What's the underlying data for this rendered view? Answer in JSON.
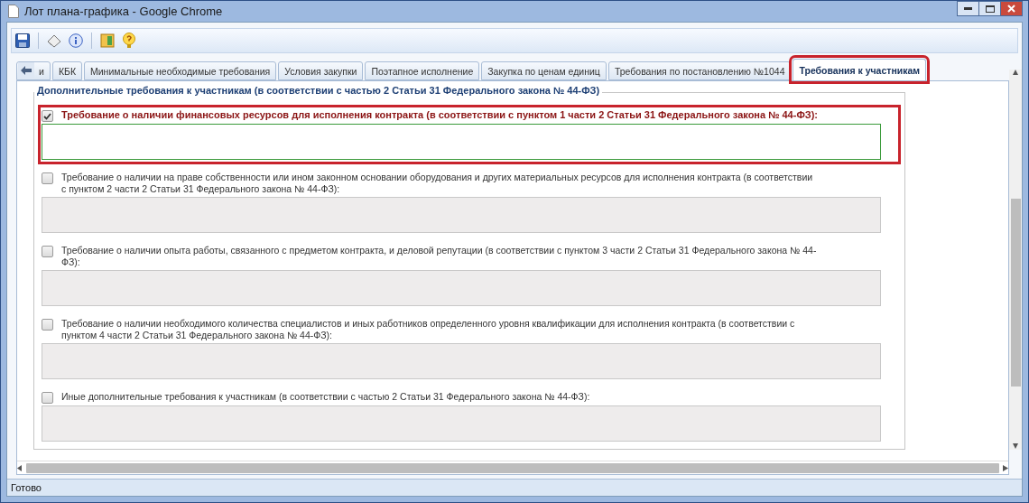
{
  "window": {
    "title": "Лот плана-графика - Google Chrome"
  },
  "tabs": [
    {
      "label": "и",
      "selected": false,
      "highlighted": false
    },
    {
      "label": "КБК",
      "selected": false,
      "highlighted": false
    },
    {
      "label": "Минимальные необходимые требования",
      "selected": false,
      "highlighted": false
    },
    {
      "label": "Условия закупки",
      "selected": false,
      "highlighted": false
    },
    {
      "label": "Поэтапное исполнение",
      "selected": false,
      "highlighted": false
    },
    {
      "label": "Закупка по ценам единиц",
      "selected": false,
      "highlighted": false
    },
    {
      "label": "Требования по постановлению №1044",
      "selected": false,
      "highlighted": false
    },
    {
      "label": "Требования к участникам",
      "selected": true,
      "highlighted": true
    }
  ],
  "group": {
    "legend": "Дополнительные требования к участникам (в соответствии с частью 2 Статьи 31 Федерального закона № 44-ФЗ)",
    "items": [
      {
        "label": "Требование о наличии финансовых ресурсов для исполнения контракта (в соответствии с пунктом 1 части 2 Статьи 31 Федерального закона № 44-ФЗ):",
        "checked": true,
        "highlighted": true
      },
      {
        "label": "Требование о наличии на праве собственности или ином законном основании оборудования и других материальных ресурсов для исполнения контракта (в соответствии с пунктом 2 части 2 Статьи 31 Федерального закона № 44-ФЗ):",
        "checked": false,
        "highlighted": false
      },
      {
        "label": "Требование о наличии опыта работы, связанного с предметом контракта, и деловой репутации (в соответствии с пунктом 3 части 2 Статьи 31 Федерального закона № 44-ФЗ):",
        "checked": false,
        "highlighted": false
      },
      {
        "label": "Требование о наличии необходимого количества специалистов и иных работников определенного уровня квалификации для исполнения контракта (в соответствии с пунктом 4 части 2 Статьи 31 Федерального закона № 44-ФЗ):",
        "checked": false,
        "highlighted": false
      },
      {
        "label": "Иные дополнительные требования к участникам (в соответствии с частью 2 Статьи 31 Федерального закона № 44-ФЗ):",
        "checked": false,
        "highlighted": false
      }
    ]
  },
  "status_bar": {
    "text": "Готово"
  }
}
